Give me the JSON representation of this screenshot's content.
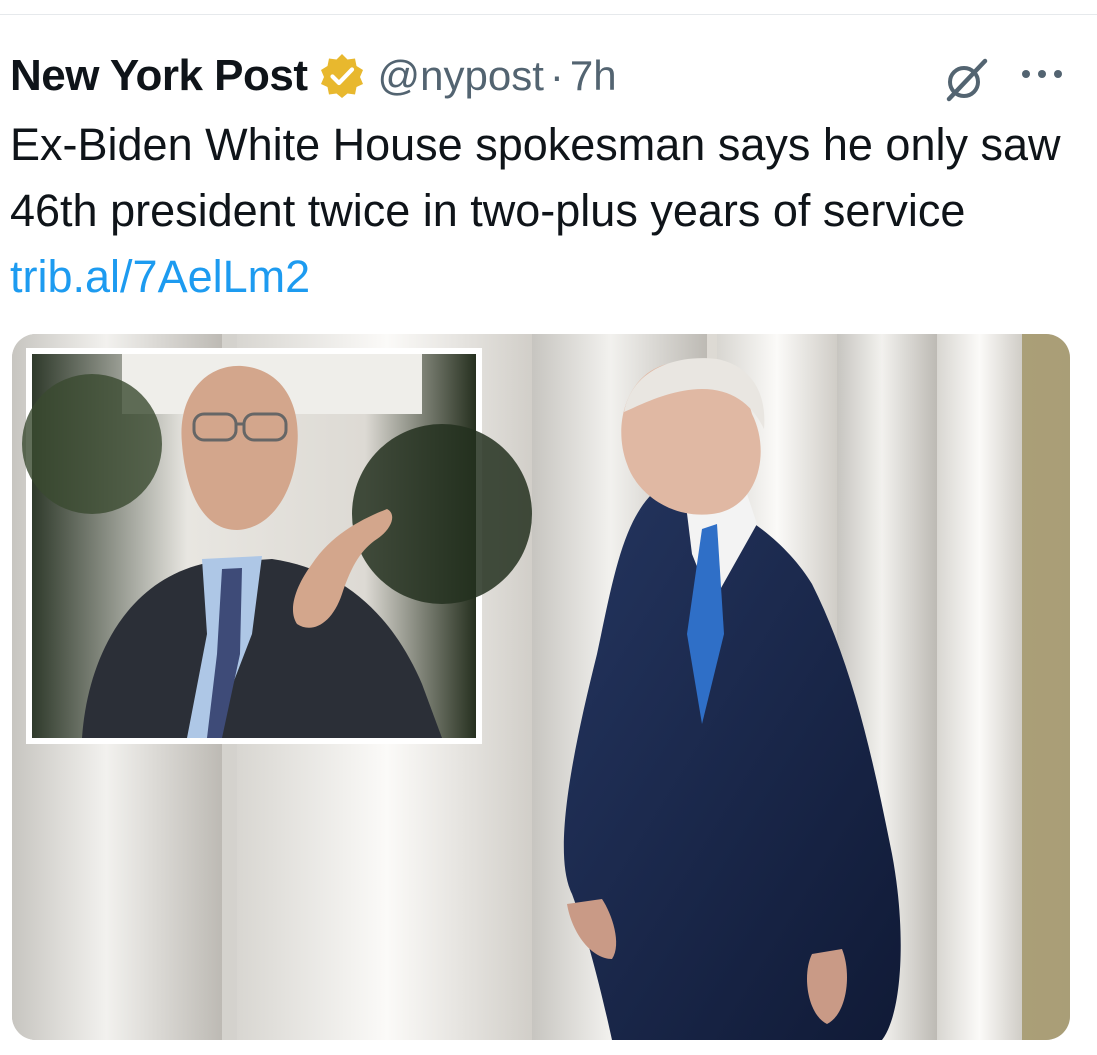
{
  "tweet": {
    "display_name": "New York Post",
    "handle": "@nypost",
    "separator": "·",
    "time": "7h",
    "text": "Ex-Biden White House spokesman says he only saw 46th president twice in two-plus years of service",
    "link_text": "trib.al/7AelLm2"
  },
  "icons": {
    "verified": "verified-badge-icon",
    "grok": "grok-icon",
    "more": "more-options-icon"
  },
  "colors": {
    "text": "#0f1419",
    "secondary": "#536471",
    "link": "#1d9bf0",
    "verified_gold": "#e8b82e"
  }
}
